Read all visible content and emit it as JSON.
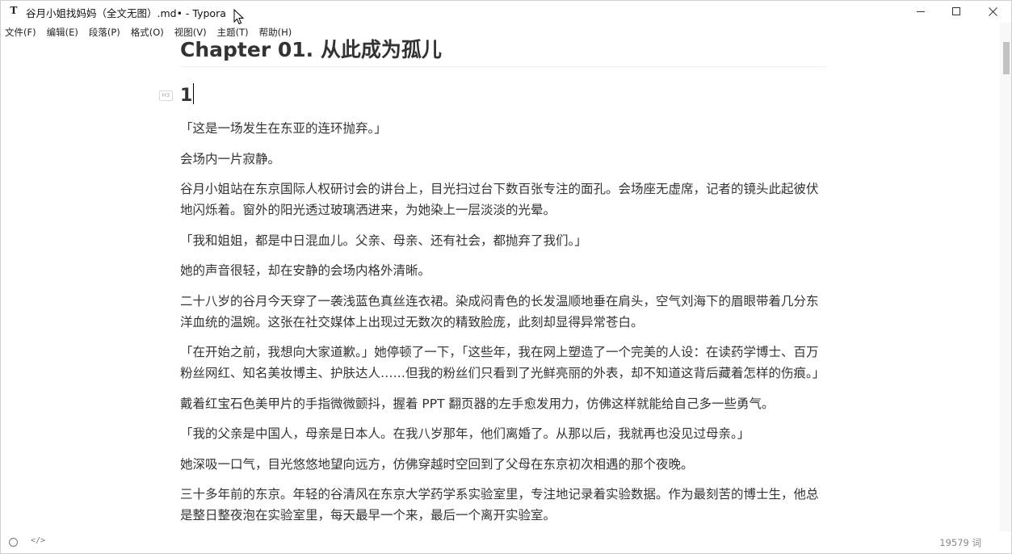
{
  "window": {
    "app_icon": "T",
    "title": "谷月小姐找妈妈（全文无图）.md• - Typora",
    "controls": {
      "minimize": "minimize-icon",
      "maximize": "maximize-icon",
      "close": "close-icon"
    }
  },
  "menu": {
    "items": [
      {
        "label": "文件(F)"
      },
      {
        "label": "编辑(E)"
      },
      {
        "label": "段落(P)"
      },
      {
        "label": "格式(O)"
      },
      {
        "label": "视图(V)"
      },
      {
        "label": "主题(T)"
      },
      {
        "label": "帮助(H)"
      }
    ]
  },
  "document": {
    "h1": "Chapter 01. 从此成为孤儿",
    "heading_marker": "H3",
    "h3": "1",
    "paragraphs": [
      "「这是一场发生在东亚的连环抛弃。」",
      "会场内一片寂静。",
      "谷月小姐站在东京国际人权研讨会的讲台上，目光扫过台下数百张专注的面孔。会场座无虚席，记者的镜头此起彼伏地闪烁着。窗外的阳光透过玻璃洒进来，为她染上一层淡淡的光晕。",
      "「我和姐姐，都是中日混血儿。父亲、母亲、还有社会，都抛弃了我们。」",
      "她的声音很轻，却在安静的会场内格外清晰。",
      "二十八岁的谷月今天穿了一袭浅蓝色真丝连衣裙。染成闷青色的长发温顺地垂在肩头，空气刘海下的眉眼带着几分东洋血统的温婉。这张在社交媒体上出现过无数次的精致脸庞，此刻却显得异常苍白。",
      "「在开始之前，我想向大家道歉。」她停顿了一下，「这些年，我在网上塑造了一个完美的人设：在读药学博士、百万粉丝网红、知名美妆博主、护肤达人……但我的粉丝们只看到了光鲜亮丽的外表，却不知道这背后藏着怎样的伤痕。」",
      "戴着红宝石色美甲片的手指微微颤抖，握着 PPT 翻页器的左手愈发用力，仿佛这样就能给自己多一些勇气。",
      "「我的父亲是中国人，母亲是日本人。在我八岁那年，他们离婚了。从那以后，我就再也没见过母亲。」",
      "她深吸一口气，目光悠悠地望向远方，仿佛穿越时空回到了父母在东京初次相遇的那个夜晚。",
      "三十多年前的东京。年轻的谷清风在东京大学药学系实验室里，专注地记录着实验数据。作为最刻苦的博士生，他总是整日整夜泡在实验室里，每天最早一个来，最后一个离开实验室。"
    ]
  },
  "footer": {
    "status_icon": "circle-icon",
    "source_toggle": "</>",
    "word_count": "19579 词"
  }
}
